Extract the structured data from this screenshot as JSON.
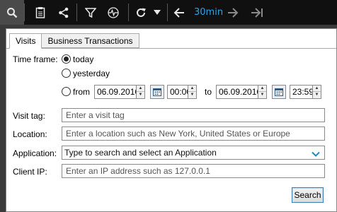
{
  "toolbar": {
    "icons": [
      "search-icon",
      "clipboard-icon",
      "share-icon",
      "filter-icon",
      "pulse-icon",
      "refresh-icon",
      "dropdown-arrow-icon",
      "arrow-left-icon",
      "arrow-right-icon",
      "jump-to-end-icon"
    ],
    "range_label": "30min"
  },
  "tabs": [
    {
      "label": "Visits",
      "active": true
    },
    {
      "label": "Business Transactions",
      "active": false
    }
  ],
  "timeframe": {
    "label": "Time frame:",
    "options": {
      "today": "today",
      "yesterday": "yesterday",
      "from": "from"
    },
    "selected": "today",
    "from_date": "06.09.2016",
    "from_time": "00:00",
    "to_label": "to",
    "to_date": "06.09.2016",
    "to_time": "23:59"
  },
  "fields": {
    "visit_tag": {
      "label": "Visit tag:",
      "placeholder": "Enter a visit tag"
    },
    "location": {
      "label": "Location:",
      "placeholder": "Enter a location such as New York, United States or Europe"
    },
    "application": {
      "label": "Application:",
      "placeholder": "Type to search and select an Application"
    },
    "client_ip": {
      "label": "Client IP:",
      "placeholder": "Enter an IP address such as 127.0.0.1"
    }
  },
  "search_button": "Search",
  "colors": {
    "accent": "#2fa3e6",
    "toolbar_bg": "#101010",
    "dropdown_chevron": "#1e8bc3"
  }
}
